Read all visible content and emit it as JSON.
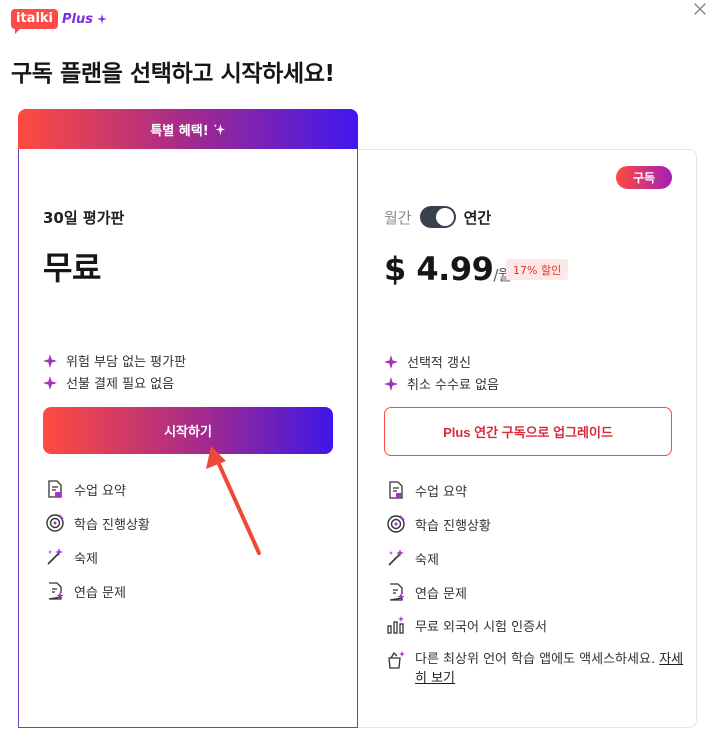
{
  "brand": {
    "logo_text": "italki",
    "plus_text": "Plus"
  },
  "title": "구독 플랜을 선택하고 시작하세요!",
  "free_plan": {
    "banner": "특별 혜택!",
    "name": "30일 평가판",
    "price": "무료",
    "bullets": [
      "위험 부담 없는 평가판",
      "선불 결제 필요 없음"
    ],
    "cta": "시작하기",
    "features": [
      {
        "icon": "lesson-summary-icon",
        "label": "수업 요약"
      },
      {
        "icon": "progress-target-icon",
        "label": "학습 진행상황"
      },
      {
        "icon": "homework-wand-icon",
        "label": "숙제"
      },
      {
        "icon": "practice-doc-icon",
        "label": "연습 문제"
      }
    ]
  },
  "paid_plan": {
    "badge": "구독",
    "billing_monthly": "월간",
    "billing_yearly": "연간",
    "billing_selected": "연간",
    "price": "$ 4.99",
    "price_unit": "/월",
    "discount": "17% 할인",
    "bullets": [
      "선택적 갱신",
      "취소 수수료 없음"
    ],
    "cta": "Plus 연간 구독으로 업그레이드",
    "features": [
      {
        "icon": "lesson-summary-icon",
        "label": "수업 요약"
      },
      {
        "icon": "progress-target-icon",
        "label": "학습 진행상황"
      },
      {
        "icon": "homework-wand-icon",
        "label": "숙제"
      },
      {
        "icon": "practice-doc-icon",
        "label": "연습 문제"
      },
      {
        "icon": "certificate-chart-icon",
        "label": "무료 외국어 시험 인증서"
      }
    ],
    "app_access_text": "다른 최상위 언어 학습 앱에도 액세스하세요.",
    "see_more": "자세히 보기"
  },
  "colors": {
    "brand_red": "#ff4b47",
    "brand_purple": "#7b2ee8",
    "gradient_start": "#ff4b3f",
    "gradient_end": "#3d17e8"
  }
}
